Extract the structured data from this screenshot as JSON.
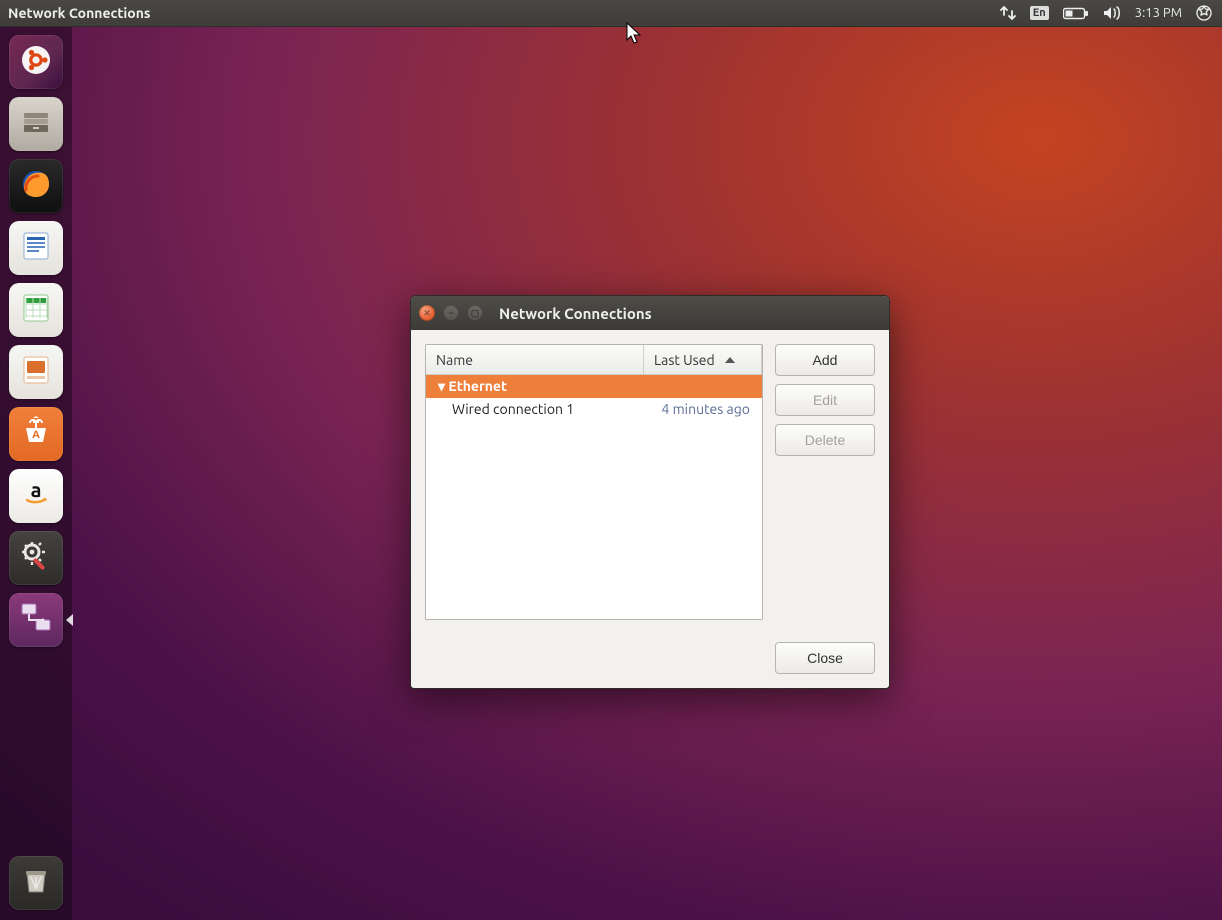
{
  "menubar": {
    "title": "Network Connections",
    "lang": "En",
    "time": "3:13 PM"
  },
  "launcher": {
    "items": [
      {
        "name": "dash",
        "bg": "linear-gradient(135deg,#772953,#5e2750 60%,#3a0d3d)",
        "icon": "ubuntu"
      },
      {
        "name": "files",
        "bg": "linear-gradient(#d9d4cc,#b0aaa0)",
        "icon": "files"
      },
      {
        "name": "firefox",
        "bg": "linear-gradient(#2a2a2a,#0f0f0f)",
        "icon": "firefox"
      },
      {
        "name": "writer",
        "bg": "linear-gradient(#f6f6f4,#e5e3dc)",
        "icon": "writer"
      },
      {
        "name": "calc",
        "bg": "linear-gradient(#f6f6f4,#e5e3dc)",
        "icon": "calc"
      },
      {
        "name": "impress",
        "bg": "linear-gradient(#f6f6f4,#e5e3dc)",
        "icon": "impress"
      },
      {
        "name": "software",
        "bg": "linear-gradient(#f07f3a,#e36a24)",
        "icon": "software"
      },
      {
        "name": "amazon",
        "bg": "linear-gradient(#ffffff,#eceae6)",
        "icon": "amazon"
      },
      {
        "name": "settings",
        "bg": "linear-gradient(#454340,#2e2c29)",
        "icon": "settings"
      },
      {
        "name": "network-connections",
        "bg": "linear-gradient(#8a3a7a,#5e2760)",
        "icon": "network",
        "active": true
      }
    ],
    "trash": {
      "name": "trash",
      "bg": "linear-gradient(#3d3b37,#2a2926)",
      "icon": "trash"
    }
  },
  "dialog": {
    "title": "Network Connections",
    "headers": {
      "name": "Name",
      "last_used": "Last Used"
    },
    "group": "Ethernet",
    "connections": [
      {
        "name": "Wired connection 1",
        "last_used": "4 minutes ago"
      }
    ],
    "buttons": {
      "add": "Add",
      "edit": "Edit",
      "delete": "Delete",
      "close": "Close"
    }
  }
}
